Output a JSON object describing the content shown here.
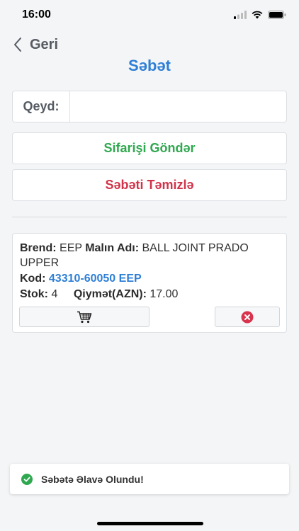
{
  "status_bar": {
    "time": "16:00"
  },
  "nav": {
    "back_label": "Geri"
  },
  "header": {
    "title": "Səbət"
  },
  "note": {
    "label": "Qeyd:",
    "value": "",
    "placeholder": ""
  },
  "actions": {
    "send_label": "Sifarişi Göndər",
    "clear_label": "Səbəti Təmizlə"
  },
  "cart_item": {
    "brand_label": "Brend:",
    "brand_value": "EEP",
    "name_label": "Malın Adı:",
    "name_value": "BALL JOINT PRADO UPPER",
    "code_label": "Kod:",
    "code_value": "43310-60050 EEP",
    "stock_label": "Stok:",
    "stock_value": "4",
    "price_label": "Qiymət(AZN):",
    "price_value": "17.00"
  },
  "toast": {
    "message": "Səbətə Əlavə Olundu!"
  },
  "colors": {
    "accent_blue": "#2e7fd6",
    "success_green": "#2fa84f",
    "danger_red": "#d0334a"
  },
  "icons": {
    "cart": "cart-icon",
    "remove": "remove-circle-icon",
    "success": "check-circle-icon",
    "back": "chevron-left-icon"
  }
}
